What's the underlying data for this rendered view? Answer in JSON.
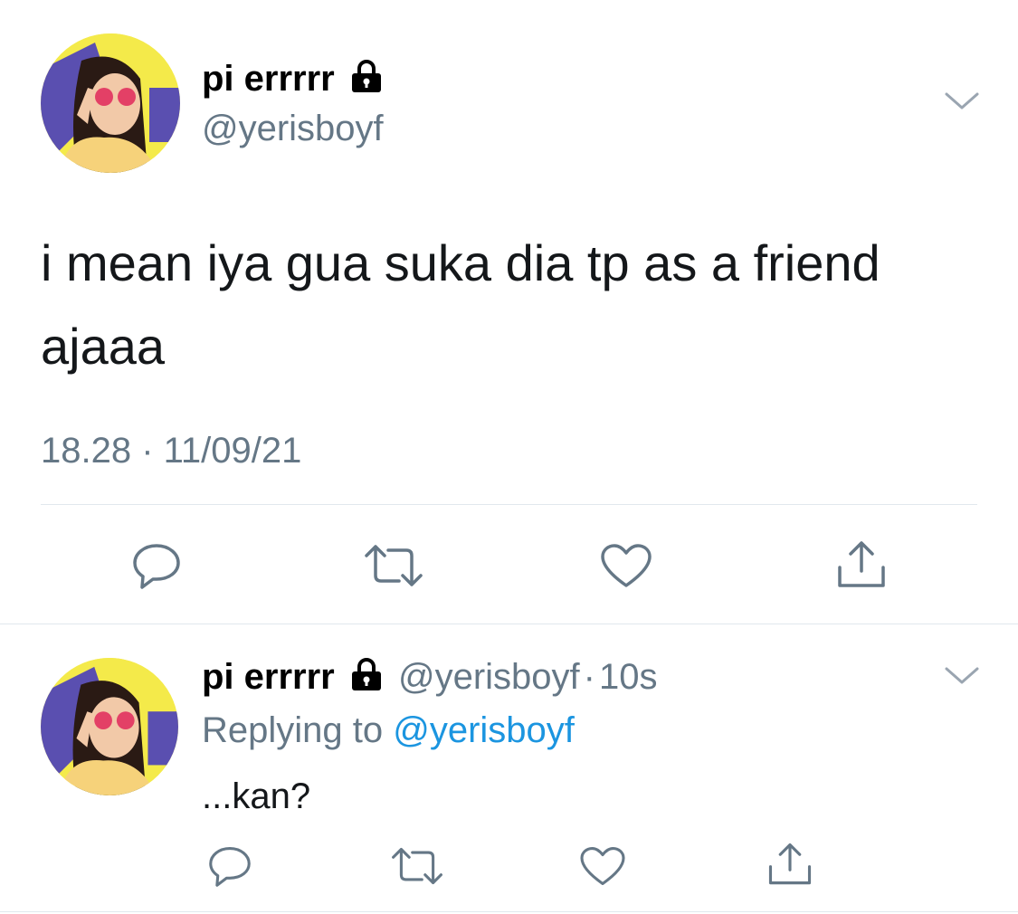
{
  "main_tweet": {
    "display_name": "pi errrrr",
    "handle": "@yerisboyf",
    "text_line1": "i mean iya gua suka dia tp as a friend",
    "text_line2": "ajaaa",
    "timestamp": "18.28 · 11/09/21"
  },
  "reply_tweet": {
    "display_name": "pi errrrr",
    "handle": "@yerisboyf",
    "separator": "·",
    "time": "10s",
    "replying_prefix": "Replying to",
    "replying_handle": "@yerisboyf",
    "text": "...kan?"
  },
  "icons": {
    "lock": "lock-icon",
    "chevron": "chevron-down-icon",
    "reply": "reply-icon",
    "retweet": "retweet-icon",
    "like": "heart-icon",
    "share": "share-icon"
  },
  "colors": {
    "icon_gray": "#657786",
    "link_blue": "#1b95e0",
    "divider": "#e1e8ed"
  }
}
